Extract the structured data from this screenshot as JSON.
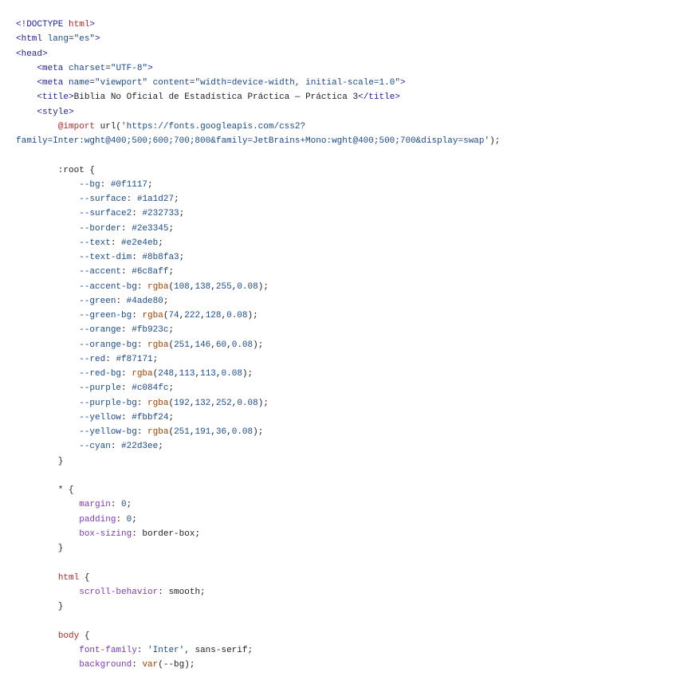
{
  "editor": {
    "colors": {
      "background": "#ffffff",
      "plain": "#222222",
      "tag": "#1f1f9a",
      "element": "#b02a2a",
      "string": "#1b4a8a",
      "property": "#7b39b8",
      "function": "#a14100",
      "variable": "#1b4a8a"
    },
    "lines": [
      [
        {
          "t": "<!DOCTYPE ",
          "c": "k"
        },
        {
          "t": "html",
          "c": "e"
        },
        {
          "t": ">",
          "c": "k"
        }
      ],
      [
        {
          "t": "<html ",
          "c": "k"
        },
        {
          "t": "lang",
          "c": "v"
        },
        {
          "t": "=",
          "c": "t"
        },
        {
          "t": "\"es\"",
          "c": "s"
        },
        {
          "t": ">",
          "c": "k"
        }
      ],
      [
        {
          "t": "<head>",
          "c": "k"
        }
      ],
      [
        {
          "t": "    <meta ",
          "c": "k"
        },
        {
          "t": "charset",
          "c": "v"
        },
        {
          "t": "=",
          "c": "t"
        },
        {
          "t": "\"UTF-8\"",
          "c": "s"
        },
        {
          "t": ">",
          "c": "k"
        }
      ],
      [
        {
          "t": "    <meta ",
          "c": "k"
        },
        {
          "t": "name",
          "c": "v"
        },
        {
          "t": "=",
          "c": "t"
        },
        {
          "t": "\"viewport\" ",
          "c": "s"
        },
        {
          "t": "content",
          "c": "v"
        },
        {
          "t": "=",
          "c": "t"
        },
        {
          "t": "\"width=device-width, initial-scale=1.0\"",
          "c": "s"
        },
        {
          "t": ">",
          "c": "k"
        }
      ],
      [
        {
          "t": "    <title>",
          "c": "k"
        },
        {
          "t": "Biblia No Oficial de Estadística Práctica — Práctica 3",
          "c": "t"
        },
        {
          "t": "</title>",
          "c": "k"
        }
      ],
      [
        {
          "t": "    <style>",
          "c": "k"
        }
      ],
      [
        {
          "t": "        ",
          "c": "t"
        },
        {
          "t": "@import",
          "c": "e"
        },
        {
          "t": " url(",
          "c": "t"
        },
        {
          "t": "'https://fonts.googleapis.com/css2?",
          "c": "s"
        }
      ],
      [
        {
          "t": "family=Inter:wght@400;500;600;700;800&family=JetBrains+Mono:wght@400;500;700&display=swap'",
          "c": "s"
        },
        {
          "t": ");",
          "c": "t"
        }
      ],
      [
        {
          "t": "",
          "c": "t"
        }
      ],
      [
        {
          "t": "        :root {",
          "c": "t"
        }
      ],
      [
        {
          "t": "            ",
          "c": "t"
        },
        {
          "t": "--bg",
          "c": "v"
        },
        {
          "t": ": ",
          "c": "t"
        },
        {
          "t": "#0f1117",
          "c": "s"
        },
        {
          "t": ";",
          "c": "t"
        }
      ],
      [
        {
          "t": "            ",
          "c": "t"
        },
        {
          "t": "--surface",
          "c": "v"
        },
        {
          "t": ": ",
          "c": "t"
        },
        {
          "t": "#1a1d27",
          "c": "s"
        },
        {
          "t": ";",
          "c": "t"
        }
      ],
      [
        {
          "t": "            ",
          "c": "t"
        },
        {
          "t": "--surface2",
          "c": "v"
        },
        {
          "t": ": ",
          "c": "t"
        },
        {
          "t": "#232733",
          "c": "s"
        },
        {
          "t": ";",
          "c": "t"
        }
      ],
      [
        {
          "t": "            ",
          "c": "t"
        },
        {
          "t": "--border",
          "c": "v"
        },
        {
          "t": ": ",
          "c": "t"
        },
        {
          "t": "#2e3345",
          "c": "s"
        },
        {
          "t": ";",
          "c": "t"
        }
      ],
      [
        {
          "t": "            ",
          "c": "t"
        },
        {
          "t": "--text",
          "c": "v"
        },
        {
          "t": ": ",
          "c": "t"
        },
        {
          "t": "#e2e4eb",
          "c": "s"
        },
        {
          "t": ";",
          "c": "t"
        }
      ],
      [
        {
          "t": "            ",
          "c": "t"
        },
        {
          "t": "--text-dim",
          "c": "v"
        },
        {
          "t": ": ",
          "c": "t"
        },
        {
          "t": "#8b8fa3",
          "c": "s"
        },
        {
          "t": ";",
          "c": "t"
        }
      ],
      [
        {
          "t": "            ",
          "c": "t"
        },
        {
          "t": "--accent",
          "c": "v"
        },
        {
          "t": ": ",
          "c": "t"
        },
        {
          "t": "#6c8aff",
          "c": "s"
        },
        {
          "t": ";",
          "c": "t"
        }
      ],
      [
        {
          "t": "            ",
          "c": "t"
        },
        {
          "t": "--accent-bg",
          "c": "v"
        },
        {
          "t": ": ",
          "c": "t"
        },
        {
          "t": "rgba",
          "c": "f"
        },
        {
          "t": "(",
          "c": "t"
        },
        {
          "t": "108",
          "c": "s"
        },
        {
          "t": ",",
          "c": "t"
        },
        {
          "t": "138",
          "c": "s"
        },
        {
          "t": ",",
          "c": "t"
        },
        {
          "t": "255",
          "c": "s"
        },
        {
          "t": ",",
          "c": "t"
        },
        {
          "t": "0.08",
          "c": "s"
        },
        {
          "t": ");",
          "c": "t"
        }
      ],
      [
        {
          "t": "            ",
          "c": "t"
        },
        {
          "t": "--green",
          "c": "v"
        },
        {
          "t": ": ",
          "c": "t"
        },
        {
          "t": "#4ade80",
          "c": "s"
        },
        {
          "t": ";",
          "c": "t"
        }
      ],
      [
        {
          "t": "            ",
          "c": "t"
        },
        {
          "t": "--green-bg",
          "c": "v"
        },
        {
          "t": ": ",
          "c": "t"
        },
        {
          "t": "rgba",
          "c": "f"
        },
        {
          "t": "(",
          "c": "t"
        },
        {
          "t": "74",
          "c": "s"
        },
        {
          "t": ",",
          "c": "t"
        },
        {
          "t": "222",
          "c": "s"
        },
        {
          "t": ",",
          "c": "t"
        },
        {
          "t": "128",
          "c": "s"
        },
        {
          "t": ",",
          "c": "t"
        },
        {
          "t": "0.08",
          "c": "s"
        },
        {
          "t": ");",
          "c": "t"
        }
      ],
      [
        {
          "t": "            ",
          "c": "t"
        },
        {
          "t": "--orange",
          "c": "v"
        },
        {
          "t": ": ",
          "c": "t"
        },
        {
          "t": "#fb923c",
          "c": "s"
        },
        {
          "t": ";",
          "c": "t"
        }
      ],
      [
        {
          "t": "            ",
          "c": "t"
        },
        {
          "t": "--orange-bg",
          "c": "v"
        },
        {
          "t": ": ",
          "c": "t"
        },
        {
          "t": "rgba",
          "c": "f"
        },
        {
          "t": "(",
          "c": "t"
        },
        {
          "t": "251",
          "c": "s"
        },
        {
          "t": ",",
          "c": "t"
        },
        {
          "t": "146",
          "c": "s"
        },
        {
          "t": ",",
          "c": "t"
        },
        {
          "t": "60",
          "c": "s"
        },
        {
          "t": ",",
          "c": "t"
        },
        {
          "t": "0.08",
          "c": "s"
        },
        {
          "t": ");",
          "c": "t"
        }
      ],
      [
        {
          "t": "            ",
          "c": "t"
        },
        {
          "t": "--red",
          "c": "v"
        },
        {
          "t": ": ",
          "c": "t"
        },
        {
          "t": "#f87171",
          "c": "s"
        },
        {
          "t": ";",
          "c": "t"
        }
      ],
      [
        {
          "t": "            ",
          "c": "t"
        },
        {
          "t": "--red-bg",
          "c": "v"
        },
        {
          "t": ": ",
          "c": "t"
        },
        {
          "t": "rgba",
          "c": "f"
        },
        {
          "t": "(",
          "c": "t"
        },
        {
          "t": "248",
          "c": "s"
        },
        {
          "t": ",",
          "c": "t"
        },
        {
          "t": "113",
          "c": "s"
        },
        {
          "t": ",",
          "c": "t"
        },
        {
          "t": "113",
          "c": "s"
        },
        {
          "t": ",",
          "c": "t"
        },
        {
          "t": "0.08",
          "c": "s"
        },
        {
          "t": ");",
          "c": "t"
        }
      ],
      [
        {
          "t": "            ",
          "c": "t"
        },
        {
          "t": "--purple",
          "c": "v"
        },
        {
          "t": ": ",
          "c": "t"
        },
        {
          "t": "#c084fc",
          "c": "s"
        },
        {
          "t": ";",
          "c": "t"
        }
      ],
      [
        {
          "t": "            ",
          "c": "t"
        },
        {
          "t": "--purple-bg",
          "c": "v"
        },
        {
          "t": ": ",
          "c": "t"
        },
        {
          "t": "rgba",
          "c": "f"
        },
        {
          "t": "(",
          "c": "t"
        },
        {
          "t": "192",
          "c": "s"
        },
        {
          "t": ",",
          "c": "t"
        },
        {
          "t": "132",
          "c": "s"
        },
        {
          "t": ",",
          "c": "t"
        },
        {
          "t": "252",
          "c": "s"
        },
        {
          "t": ",",
          "c": "t"
        },
        {
          "t": "0.08",
          "c": "s"
        },
        {
          "t": ");",
          "c": "t"
        }
      ],
      [
        {
          "t": "            ",
          "c": "t"
        },
        {
          "t": "--yellow",
          "c": "v"
        },
        {
          "t": ": ",
          "c": "t"
        },
        {
          "t": "#fbbf24",
          "c": "s"
        },
        {
          "t": ";",
          "c": "t"
        }
      ],
      [
        {
          "t": "            ",
          "c": "t"
        },
        {
          "t": "--yellow-bg",
          "c": "v"
        },
        {
          "t": ": ",
          "c": "t"
        },
        {
          "t": "rgba",
          "c": "f"
        },
        {
          "t": "(",
          "c": "t"
        },
        {
          "t": "251",
          "c": "s"
        },
        {
          "t": ",",
          "c": "t"
        },
        {
          "t": "191",
          "c": "s"
        },
        {
          "t": ",",
          "c": "t"
        },
        {
          "t": "36",
          "c": "s"
        },
        {
          "t": ",",
          "c": "t"
        },
        {
          "t": "0.08",
          "c": "s"
        },
        {
          "t": ");",
          "c": "t"
        }
      ],
      [
        {
          "t": "            ",
          "c": "t"
        },
        {
          "t": "--cyan",
          "c": "v"
        },
        {
          "t": ": ",
          "c": "t"
        },
        {
          "t": "#22d3ee",
          "c": "s"
        },
        {
          "t": ";",
          "c": "t"
        }
      ],
      [
        {
          "t": "        }",
          "c": "t"
        }
      ],
      [
        {
          "t": "",
          "c": "t"
        }
      ],
      [
        {
          "t": "        * {",
          "c": "t"
        }
      ],
      [
        {
          "t": "            ",
          "c": "t"
        },
        {
          "t": "margin",
          "c": "p"
        },
        {
          "t": ": ",
          "c": "t"
        },
        {
          "t": "0",
          "c": "s"
        },
        {
          "t": ";",
          "c": "t"
        }
      ],
      [
        {
          "t": "            ",
          "c": "t"
        },
        {
          "t": "padding",
          "c": "p"
        },
        {
          "t": ": ",
          "c": "t"
        },
        {
          "t": "0",
          "c": "s"
        },
        {
          "t": ";",
          "c": "t"
        }
      ],
      [
        {
          "t": "            ",
          "c": "t"
        },
        {
          "t": "box-sizing",
          "c": "p"
        },
        {
          "t": ": border-box;",
          "c": "t"
        }
      ],
      [
        {
          "t": "        }",
          "c": "t"
        }
      ],
      [
        {
          "t": "",
          "c": "t"
        }
      ],
      [
        {
          "t": "        ",
          "c": "t"
        },
        {
          "t": "html",
          "c": "e"
        },
        {
          "t": " {",
          "c": "t"
        }
      ],
      [
        {
          "t": "            ",
          "c": "t"
        },
        {
          "t": "scroll-behavior",
          "c": "p"
        },
        {
          "t": ": smooth;",
          "c": "t"
        }
      ],
      [
        {
          "t": "        }",
          "c": "t"
        }
      ],
      [
        {
          "t": "",
          "c": "t"
        }
      ],
      [
        {
          "t": "        ",
          "c": "t"
        },
        {
          "t": "body",
          "c": "e"
        },
        {
          "t": " {",
          "c": "t"
        }
      ],
      [
        {
          "t": "            ",
          "c": "t"
        },
        {
          "t": "font-family",
          "c": "p"
        },
        {
          "t": ": ",
          "c": "t"
        },
        {
          "t": "'Inter'",
          "c": "s"
        },
        {
          "t": ", sans-serif;",
          "c": "t"
        }
      ],
      [
        {
          "t": "            ",
          "c": "t"
        },
        {
          "t": "background",
          "c": "p"
        },
        {
          "t": ": ",
          "c": "t"
        },
        {
          "t": "var",
          "c": "f"
        },
        {
          "t": "(--bg);",
          "c": "t"
        }
      ]
    ]
  }
}
